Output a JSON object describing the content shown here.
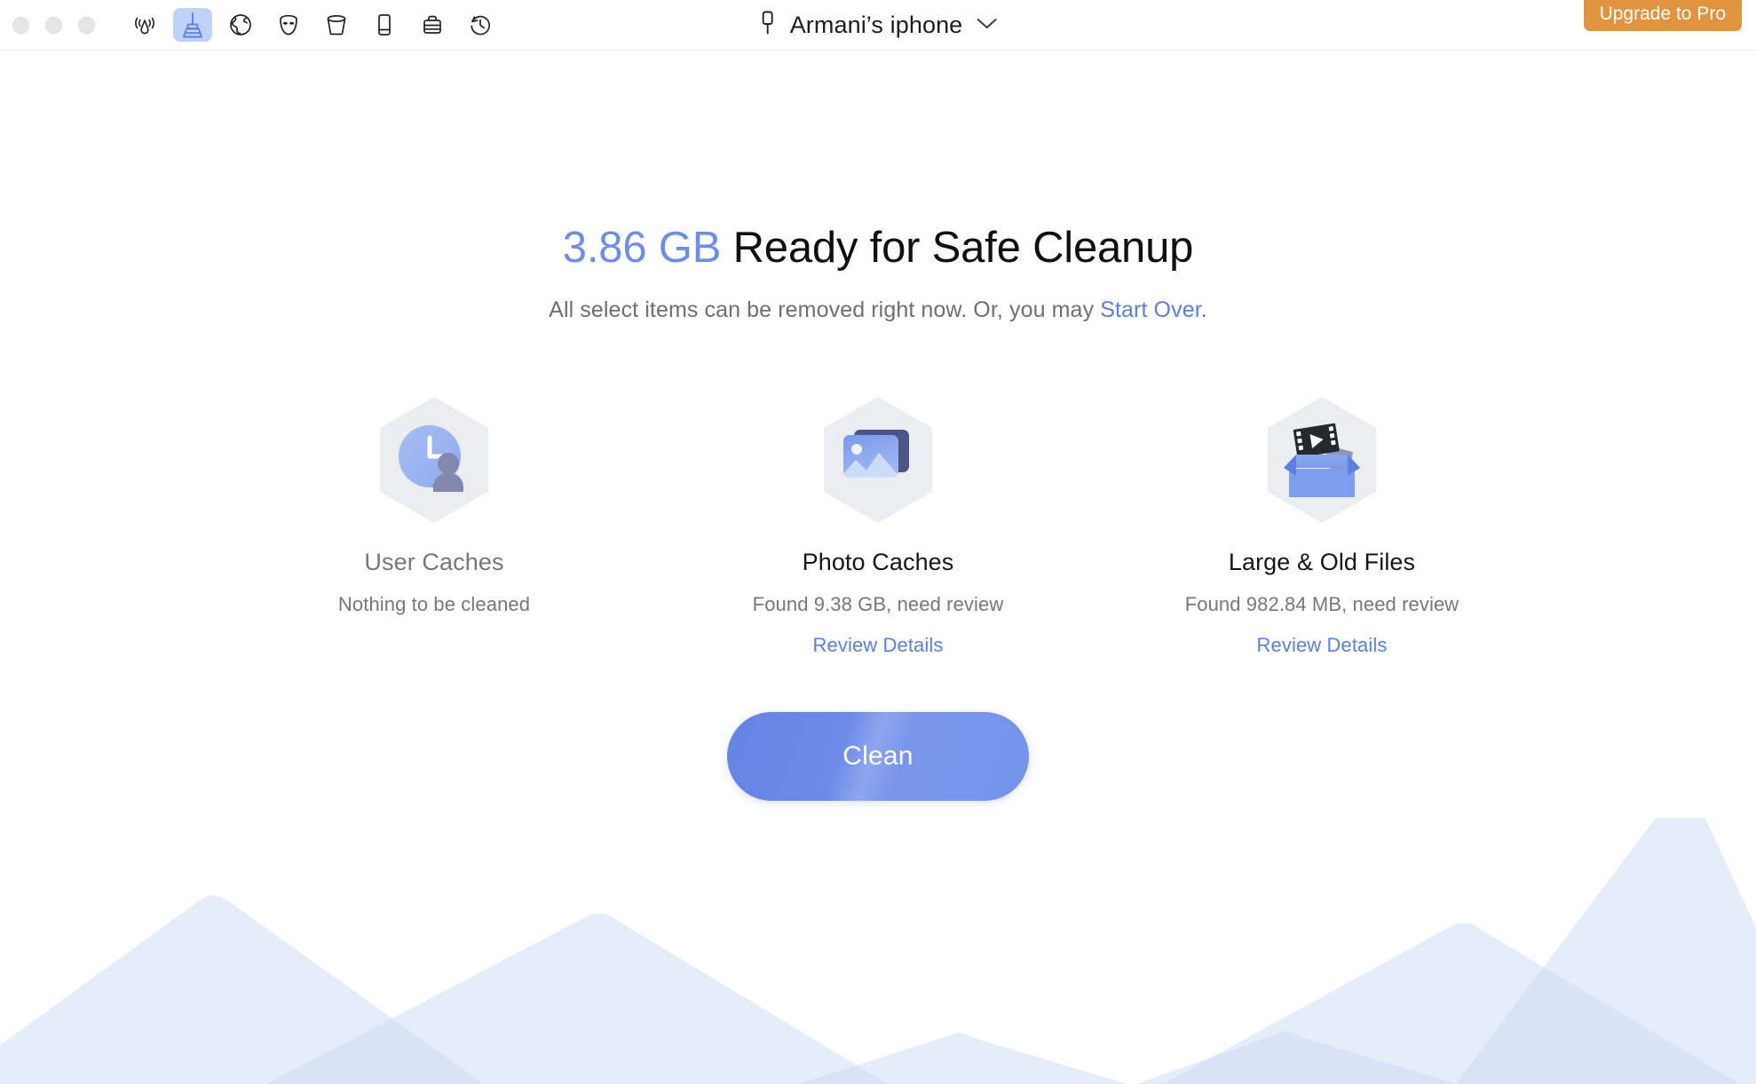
{
  "window": {
    "traffic_lights": [
      "close",
      "minimize",
      "zoom"
    ]
  },
  "toolbar": {
    "items": [
      {
        "name": "broadcast-icon",
        "label": "Broadcast",
        "active": false
      },
      {
        "name": "broom-icon",
        "label": "Cleanup",
        "active": true
      },
      {
        "name": "globe-icon",
        "label": "Internet",
        "active": false
      },
      {
        "name": "mask-icon",
        "label": "Privacy",
        "active": false
      },
      {
        "name": "trash-icon",
        "label": "Trash",
        "active": false
      },
      {
        "name": "phone-icon",
        "label": "Device",
        "active": false
      },
      {
        "name": "briefcase-icon",
        "label": "Toolbox",
        "active": false
      },
      {
        "name": "clock-history-icon",
        "label": "History",
        "active": false
      }
    ]
  },
  "device": {
    "name": "Armani’s iphone",
    "icon": "lightning-connector-icon",
    "chevron": "chevron-down-icon"
  },
  "upgrade": {
    "label": "Upgrade to Pro",
    "color": "#e0943f"
  },
  "headline": {
    "size": "3.86 GB",
    "rest": " Ready for Safe Cleanup",
    "size_color": "#6e8de4"
  },
  "subheadline": {
    "before": "All select items can be removed right now. Or, you may ",
    "link": "Start Over",
    "after": ".",
    "link_color": "#5a7fe0"
  },
  "cards": [
    {
      "icon": "user-caches-icon",
      "title": "User Caches",
      "status": "Nothing to be cleaned",
      "action": "",
      "muted": true
    },
    {
      "icon": "photo-caches-icon",
      "title": "Photo Caches",
      "status": "Found 9.38 GB, need review",
      "action": "Review Details",
      "muted": false
    },
    {
      "icon": "large-old-files-icon",
      "title": "Large & Old Files",
      "status": "Found 982.84 MB, need review",
      "action": "Review Details",
      "muted": false
    }
  ],
  "primary_action": {
    "label": "Clean",
    "color": "#6e8ce1"
  },
  "decoration": {
    "mountains_color": "#e8eefb"
  }
}
